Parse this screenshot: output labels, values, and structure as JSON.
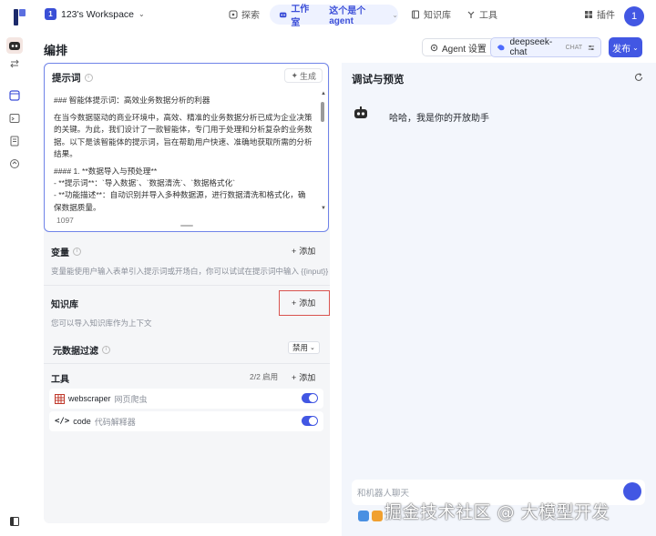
{
  "workspace": {
    "badge": "1",
    "name": "123's Workspace"
  },
  "nav": {
    "explore": "探索",
    "workroom": "工作室",
    "agent_name": "这个是个agent",
    "knowledge": "知识库",
    "tools": "工具",
    "plugins": "插件",
    "user_avatar": "1"
  },
  "header": {
    "title": "编排",
    "agent_settings": "Agent 设置",
    "model_name": "deepseek-chat",
    "model_tag": "CHAT",
    "publish": "发布"
  },
  "prompt": {
    "label": "提示词",
    "generate": "生成",
    "lines": [
      "### 智能体提示词：高效业务数据分析的利器",
      "在当今数据驱动的商业环境中，高效、精准的业务数据分析已成为企业决策的关键。为此，我们设计了一款智能体，专门用于处理和分析复杂的业务数据。以下是该智能体的提示词，旨在帮助用户快速、准确地获取所需的分析结果。",
      "#### 1. **数据导入与预处理**",
      "- **提示词**：`导入数据`、`数据清洗`、`数据格式化`",
      "- **功能描述**：自动识别并导入多种数据源，进行数据清洗和格式化，确保数据质量。"
    ],
    "char_count": "1097"
  },
  "variables": {
    "label": "变量",
    "add": "添加",
    "description": "变量能使用户输入表单引入提示词或开场白，你可以试试在提示词中输入 {{input}}"
  },
  "knowledge": {
    "label": "知识库",
    "add": "添加",
    "description": "您可以导入知识库作为上下文"
  },
  "metadata_filter": {
    "label": "元数据过滤",
    "value": "禁用"
  },
  "tools": {
    "label": "工具",
    "count": "2/2 启用",
    "add": "添加",
    "items": [
      {
        "name": "webscraper",
        "desc": "网页爬虫",
        "enabled": true
      },
      {
        "name": "code",
        "desc": "代码解释器",
        "enabled": true
      }
    ]
  },
  "preview": {
    "title": "调试与预览",
    "greeting": "哈哈，我是你的开放助手",
    "input_placeholder": "和机器人聊天"
  },
  "watermark": "掘金技术社区 @ 大模型开发"
}
